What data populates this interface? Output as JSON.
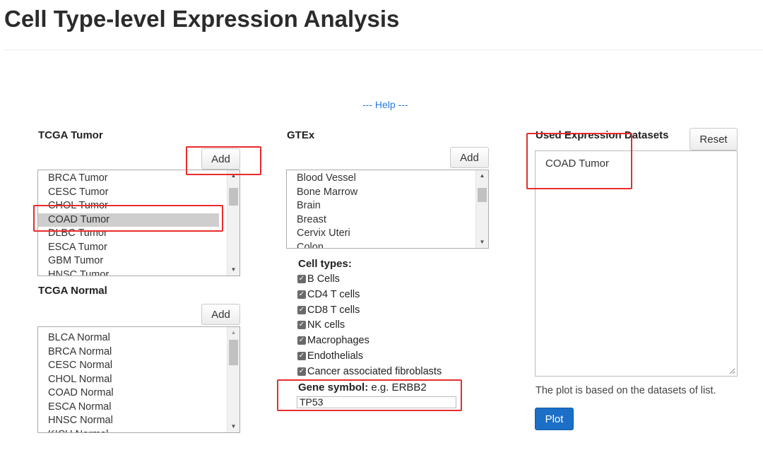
{
  "page": {
    "title": "Cell Type-level Expression Analysis",
    "help_link": "--- Help ---"
  },
  "tcga_tumor": {
    "label": "TCGA Tumor",
    "add_label": "Add",
    "options": [
      "BRCA Tumor",
      "CESC Tumor",
      "CHOL Tumor",
      "COAD Tumor",
      "DLBC Tumor",
      "ESCA Tumor",
      "GBM Tumor",
      "HNSC Tumor"
    ],
    "selected": "COAD Tumor"
  },
  "tcga_normal": {
    "label": "TCGA Normal",
    "add_label": "Add",
    "options": [
      "BLCA Normal",
      "BRCA Normal",
      "CESC Normal",
      "CHOL Normal",
      "COAD Normal",
      "ESCA Normal",
      "HNSC Normal",
      "KICH Normal"
    ]
  },
  "gtex": {
    "label": "GTEx",
    "add_label": "Add",
    "options": [
      "Blood Vessel",
      "Bone Marrow",
      "Brain",
      "Breast",
      "Cervix Uteri",
      "Colon"
    ]
  },
  "cell_types": {
    "label": "Cell types:",
    "items": [
      {
        "label": "B Cells",
        "checked": true
      },
      {
        "label": "CD4 T cells",
        "checked": true
      },
      {
        "label": "CD8 T cells",
        "checked": true
      },
      {
        "label": "NK cells",
        "checked": true
      },
      {
        "label": "Macrophages",
        "checked": true
      },
      {
        "label": "Endothelials",
        "checked": true
      },
      {
        "label": "Cancer associated fibroblasts",
        "checked": true
      }
    ]
  },
  "gene": {
    "label": "Gene symbol:",
    "example": "e.g. ERBB2",
    "value": "TP53"
  },
  "datasets": {
    "label": "Used Expression Datasets",
    "reset_label": "Reset",
    "content": "COAD Tumor",
    "note": "The plot is based on the datasets of list.",
    "plot_label": "Plot"
  },
  "colors": {
    "accent": "#1b6fc7",
    "highlight": "#e82c2c",
    "link": "#2a7ae2"
  }
}
